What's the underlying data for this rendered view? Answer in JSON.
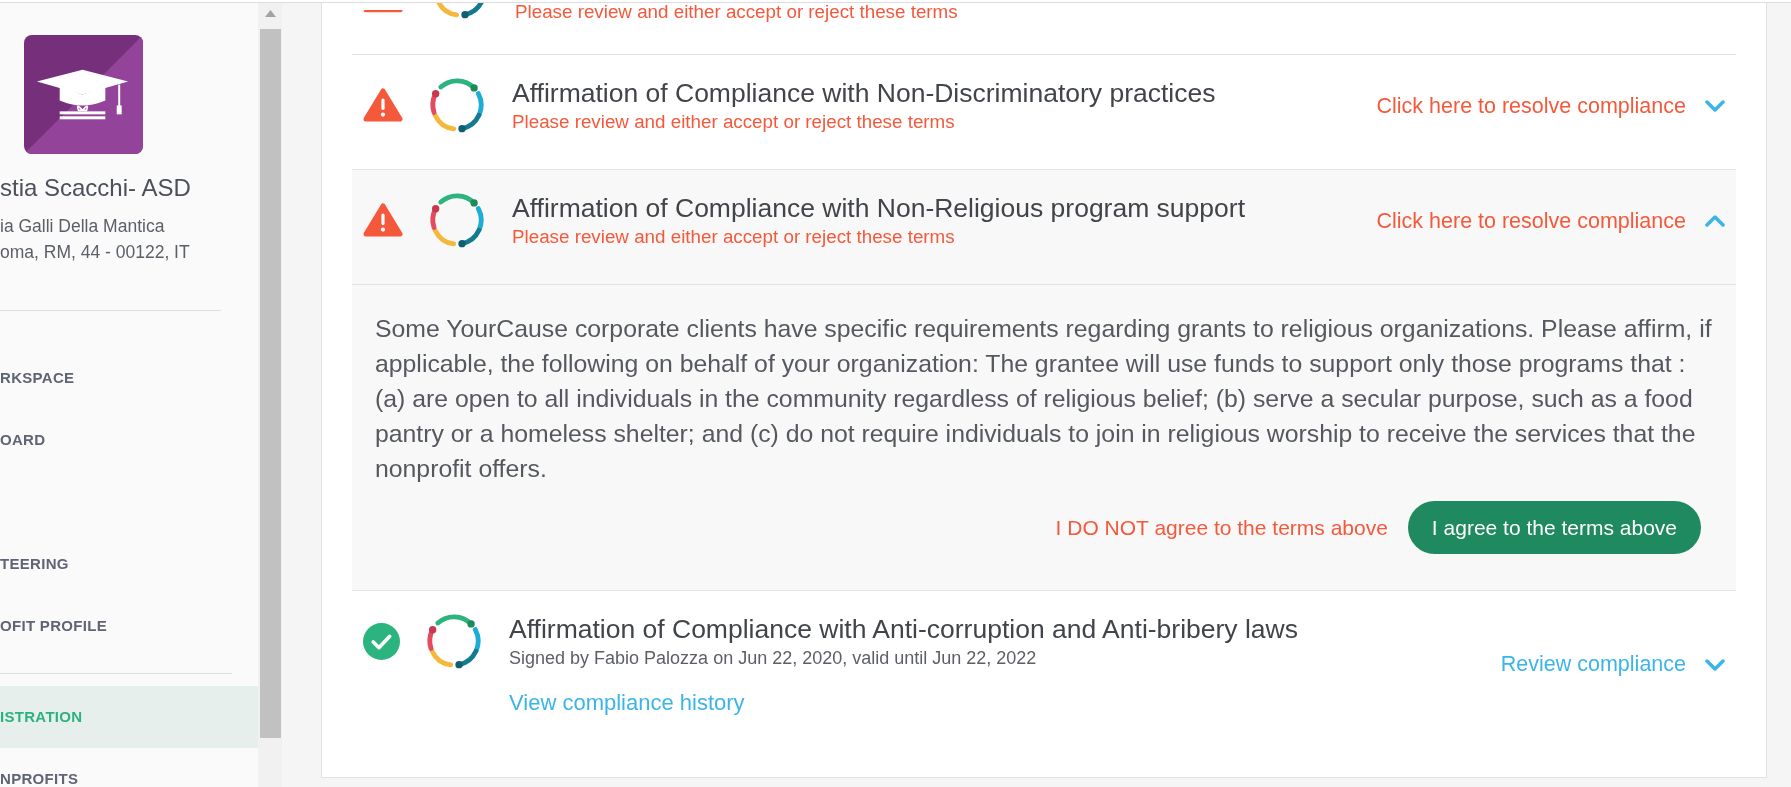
{
  "sidebar": {
    "organization": "stia Scacchi- ASD",
    "address": [
      "ia Galli Della Mantica",
      "oma, RM, 44 - 00122, IT"
    ],
    "nav_groups": [
      [
        {
          "label": "RKSPACE",
          "selected": false
        },
        {
          "label": "OARD",
          "selected": false
        },
        {
          "label": "TEERING",
          "selected": false
        },
        {
          "label": "OFIT PROFILE",
          "selected": false
        }
      ],
      [
        {
          "label": "ISTRATION",
          "selected": true
        },
        {
          "label": "NPROFITS",
          "selected": false
        }
      ]
    ]
  },
  "compliance_items": [
    {
      "kind": "pending",
      "subtitle": "Please review and either accept or reject these terms"
    },
    {
      "kind": "pending",
      "title": "Affirmation of Compliance with Non-Discriminatory practices",
      "subtitle": "Please review and either accept or reject these terms",
      "action": "Click here to resolve compliance",
      "expanded": false
    },
    {
      "kind": "pending",
      "title": "Affirmation of Compliance with Non-Religious program support",
      "subtitle": "Please review and either accept or reject these terms",
      "action": "Click here to resolve compliance",
      "expanded": true,
      "terms": "Some YourCause corporate clients have specific requirements regarding grants to religious organizations. Please affirm, if applicable, the following on behalf of your organization: The grantee will use funds to support only those programs that : (a) are open to all individuals in the community regardless of religious belief; (b) serve a secular purpose, such as a food pantry or a homeless shelter; and (c) do not require individuals to join in religious worship to receive the services that the nonprofit offers.",
      "buttons": [
        {
          "label": "I DO NOT agree to the terms above",
          "kind": "decline"
        },
        {
          "label": "I agree to the terms above",
          "kind": "primary"
        }
      ]
    },
    {
      "kind": "signed",
      "title": "Affirmation of Compliance with Anti-corruption and Anti-bribery laws",
      "subtitle": "Signed by Fabio Palozza on Jun 22, 2020, valid until Jun 22, 2022",
      "history_link": "View compliance history",
      "action": "Review compliance",
      "expanded": false
    }
  ]
}
